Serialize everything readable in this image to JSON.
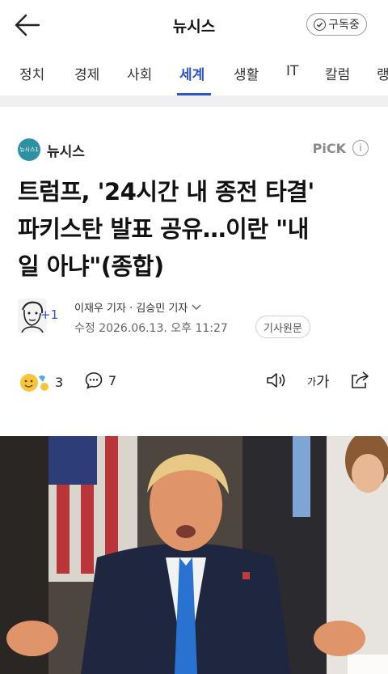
{
  "header": {
    "brand": "뉴시스",
    "subscribe_label": "구독중"
  },
  "tabs": [
    {
      "label": "정치"
    },
    {
      "label": "경제"
    },
    {
      "label": "사회"
    },
    {
      "label": "세계",
      "active": true
    },
    {
      "label": "생활"
    },
    {
      "label": "IT"
    },
    {
      "label": "칼럼"
    },
    {
      "label": "랭"
    }
  ],
  "article": {
    "press_name": "뉴시스",
    "press_logo_text": "뉴시스1",
    "pick_label": "PiCK",
    "headline_lines": [
      "트럼프, '24시간 내 종전 타결'",
      "파키스탄 발표 공유…이란 \"내",
      "일 아냐\"(종합)"
    ],
    "reporter_count": "+1",
    "reporters": "이재우 기자 · 김승민 기자",
    "updated": "수정 2026.06.13. 오후 11:27",
    "original_link": "기사원문",
    "reaction_count": "3",
    "comment_count": "7",
    "font_size_label_small": "가",
    "font_size_label_large": "가"
  },
  "colors": {
    "accent": "#2f56c9",
    "press_logo": "#2f8fa3"
  },
  "icons": [
    "back-arrow-icon",
    "check-icon",
    "info-icon",
    "reaction-emoji-icon",
    "comment-icon",
    "speaker-icon",
    "share-icon",
    "chevron-down-icon"
  ]
}
